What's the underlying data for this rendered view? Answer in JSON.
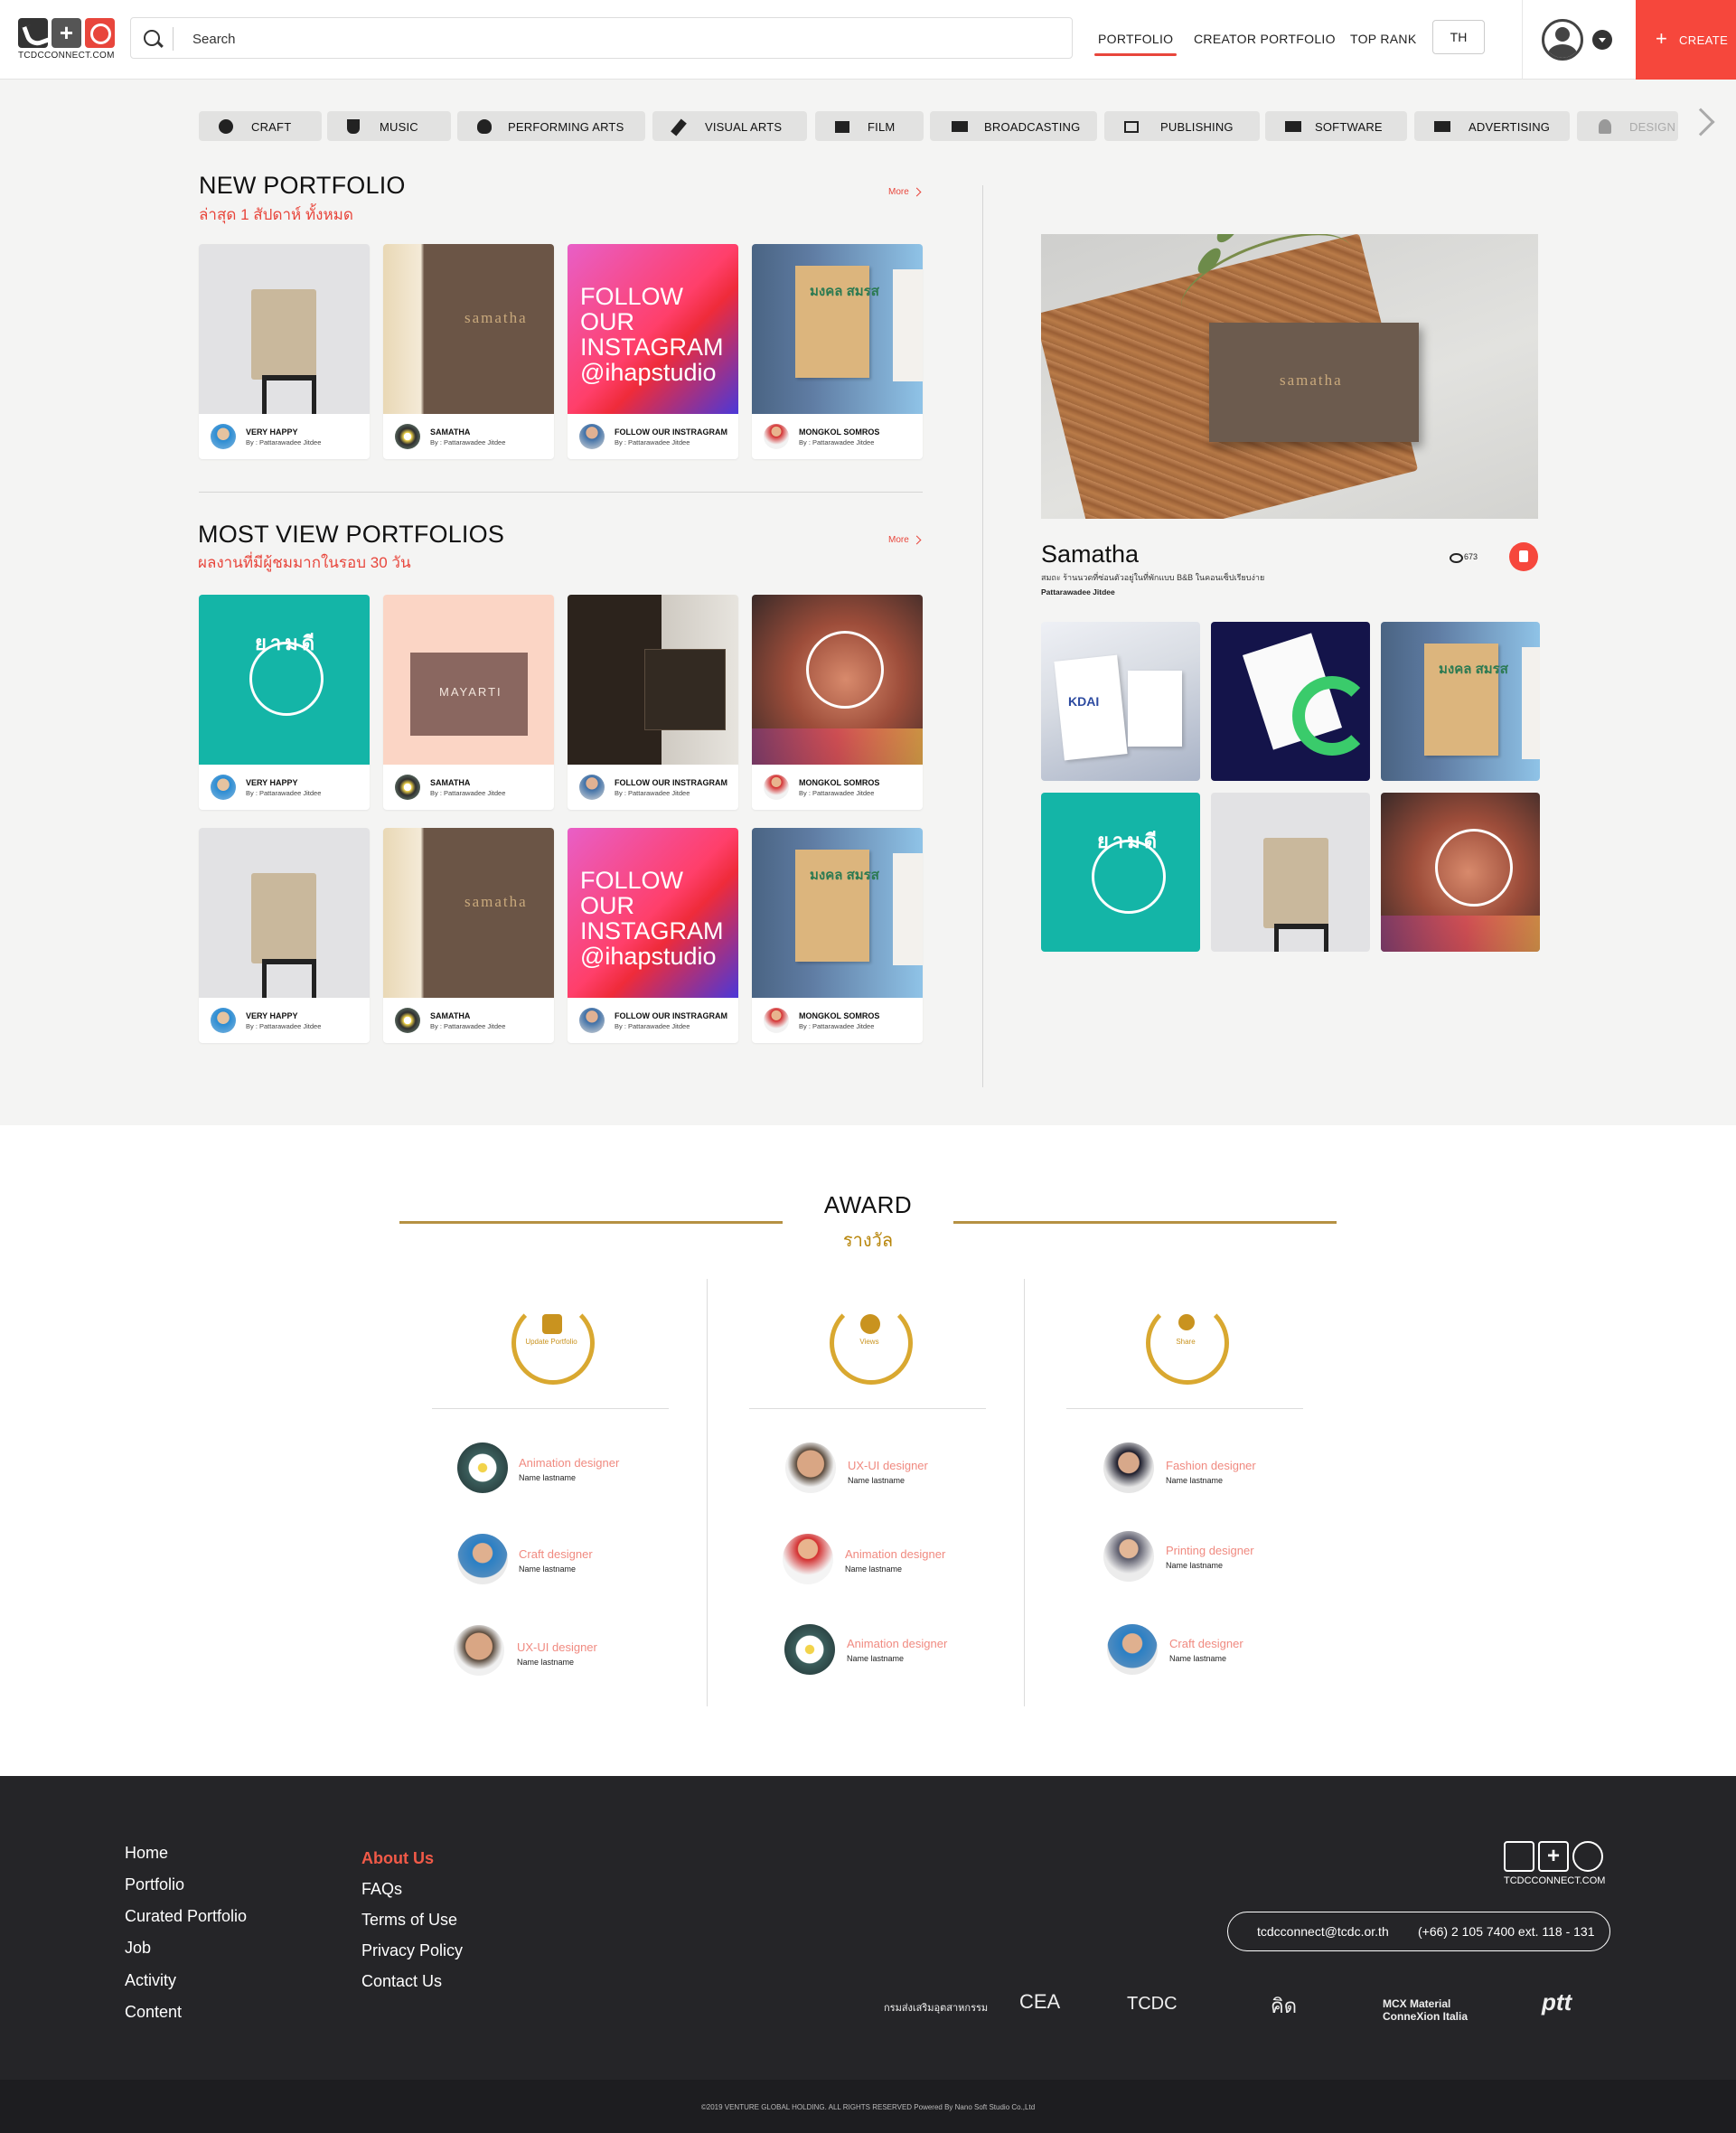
{
  "header": {
    "logo_text": "TCDCCONNECT.COM",
    "search_placeholder": "Search",
    "nav": [
      "PORTFOLIO",
      "CREATOR PORTFOLIO",
      "TOP RANK"
    ],
    "lang": "TH",
    "create_label": "CREATE"
  },
  "categories": [
    {
      "label": "CRAFT",
      "icon": "craft-icon"
    },
    {
      "label": "MUSIC",
      "icon": "music-icon"
    },
    {
      "label": "PERFORMING ARTS",
      "icon": "performing-arts-icon"
    },
    {
      "label": "VISUAL ARTS",
      "icon": "brush-icon"
    },
    {
      "label": "FILM",
      "icon": "film-icon"
    },
    {
      "label": "BROADCASTING",
      "icon": "video-camera-icon"
    },
    {
      "label": "PUBLISHING",
      "icon": "cast-icon"
    },
    {
      "label": "SOFTWARE",
      "icon": "laptop-icon"
    },
    {
      "label": "ADVERTISING",
      "icon": "ad-icon"
    },
    {
      "label": "DESIGN",
      "icon": "design-icon"
    }
  ],
  "new_portfolio": {
    "title": "NEW PORTFOLIO",
    "subtitle": "ล่าสุด 1 สัปดาห์ ทั้งหมด",
    "more": "More",
    "cards": [
      {
        "title": "VERY HAPPY",
        "by": "By : Pattarawadee Jitdee"
      },
      {
        "title": "SAMATHA",
        "by": "By : Pattarawadee Jitdee"
      },
      {
        "title": "FOLLOW OUR INSTRAGRAM",
        "by": "By : Pattarawadee Jitdee"
      },
      {
        "title": "MONGKOL SOMROS",
        "by": "By : Pattarawadee Jitdee"
      }
    ]
  },
  "most_view": {
    "title": "MOST VIEW PORTFOLIOS",
    "subtitle": "ผลงานที่มีผู้ชมมากในรอบ 30 วัน",
    "more": "More",
    "cards": [
      {
        "title": "VERY HAPPY",
        "by": "By : Pattarawadee Jitdee"
      },
      {
        "title": "SAMATHA",
        "by": "By : Pattarawadee Jitdee"
      },
      {
        "title": "FOLLOW OUR INSTRAGRAM",
        "by": "By : Pattarawadee Jitdee"
      },
      {
        "title": "MONGKOL SOMROS",
        "by": "By : Pattarawadee Jitdee"
      },
      {
        "title": "VERY HAPPY",
        "by": "By : Pattarawadee Jitdee"
      },
      {
        "title": "SAMATHA",
        "by": "By : Pattarawadee Jitdee"
      },
      {
        "title": "FOLLOW OUR INSTRAGRAM",
        "by": "By : Pattarawadee Jitdee"
      },
      {
        "title": "MONGKOL SOMROS",
        "by": "By : Pattarawadee Jitdee"
      }
    ]
  },
  "image_text": {
    "samatha": "samatha",
    "follow": "FOLLOW OUR INSTAGRAM @ihapstudio",
    "mongkol": "มงคล สมรส",
    "yarmdee": "ยามดี",
    "shop": "MAYARTI",
    "kdai": "KDAI"
  },
  "featured": {
    "title": "Samatha",
    "description": "สมถะ ร้านนวดที่ซ่อนตัวอยู่ในที่พักแบบ B&B ในคอนเซ็ปเรียบง่าย",
    "author": "Pattarawadee Jitdee",
    "views": "673"
  },
  "award": {
    "title": "AWARD",
    "subtitle": "รางวัล",
    "columns": [
      {
        "badge": "Update Portfolio",
        "winners": [
          {
            "role": "Animation designer",
            "name": "Name lastname"
          },
          {
            "role": "Craft designer",
            "name": "Name lastname"
          },
          {
            "role": "UX-UI designer",
            "name": "Name lastname"
          }
        ]
      },
      {
        "badge": "Views",
        "winners": [
          {
            "role": "UX-UI designer",
            "name": "Name lastname"
          },
          {
            "role": "Animation designer",
            "name": "Name lastname"
          },
          {
            "role": "Animation designer",
            "name": "Name lastname"
          }
        ]
      },
      {
        "badge": "Share",
        "winners": [
          {
            "role": "Fashion designer",
            "name": "Name lastname"
          },
          {
            "role": "Printing designer",
            "name": "Name lastname"
          },
          {
            "role": "Craft designer",
            "name": "Name lastname"
          }
        ]
      }
    ]
  },
  "footer": {
    "links_col1": [
      "Home",
      "Portfolio",
      "Curated Portfolio",
      "Job",
      "Activity",
      "Content"
    ],
    "links_col2": [
      "About Us",
      "FAQs",
      "Terms of Use",
      "Privacy Policy",
      "Contact Us"
    ],
    "logo_text": "TCDCCONNECT.COM",
    "email": "tcdcconnect@tcdc.or.th",
    "phone": "(+66) 2 105 7400 ext. 118 - 131",
    "partners": [
      "กรมส่งเสริมอุตสาหกรรม",
      "CEA",
      "TCDC",
      "คิด",
      "MCX Material ConneXion Italia",
      "ptt"
    ],
    "copyright": "©2019 VENTURE GLOBAL HOLDING. ALL RIGHTS RESERVED Powered By Nano Soft Studio Co.,Ltd"
  },
  "colors": {
    "accent": "#f6473c",
    "gold": "#b59143",
    "footer": "#252528"
  }
}
